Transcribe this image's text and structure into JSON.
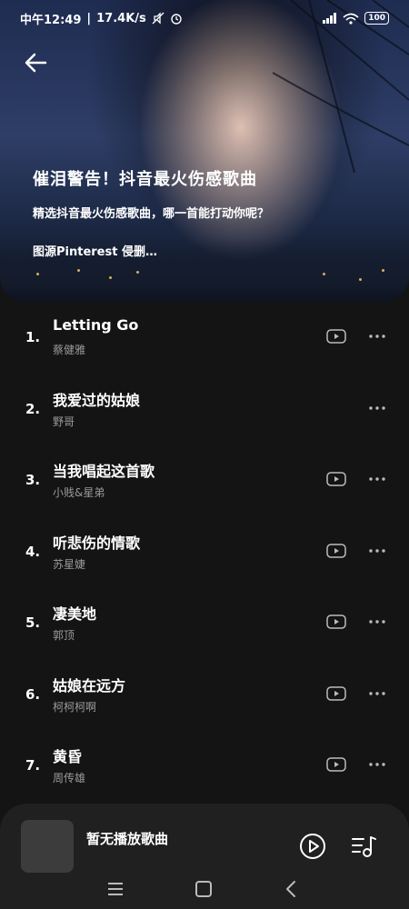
{
  "status_bar": {
    "time": "中午12:49",
    "speed": "17.4K/s",
    "battery": "100"
  },
  "header": {
    "title": "催泪警告！抖音最火伤感歌曲",
    "subtitle": "精选抖音最火伤感歌曲，哪一首能打动你呢？",
    "credit": "图源Pinterest 侵删…"
  },
  "songs": [
    {
      "index": "1.",
      "title": "Letting Go",
      "artist": "蔡健雅"
    },
    {
      "index": "2.",
      "title": "我爱过的姑娘",
      "artist": "野哥"
    },
    {
      "index": "3.",
      "title": "当我唱起这首歌",
      "artist": "小贱&星弟"
    },
    {
      "index": "4.",
      "title": "听悲伤的情歌",
      "artist": "苏星婕"
    },
    {
      "index": "5.",
      "title": "凄美地",
      "artist": "郭顶"
    },
    {
      "index": "6.",
      "title": "姑娘在远方",
      "artist": "柯柯柯啊"
    },
    {
      "index": "7.",
      "title": "黄昏",
      "artist": "周传雄"
    }
  ],
  "player": {
    "now_playing": "暂无播放歌曲"
  },
  "icons": {
    "back": "arrow-left-icon",
    "video": "video-icon",
    "more": "more-dots-icon",
    "play": "play-circle-icon",
    "queue": "playlist-icon"
  },
  "colors": {
    "background": "#141414",
    "player_background": "#202020",
    "secondary_text": "#9a9a9a"
  }
}
